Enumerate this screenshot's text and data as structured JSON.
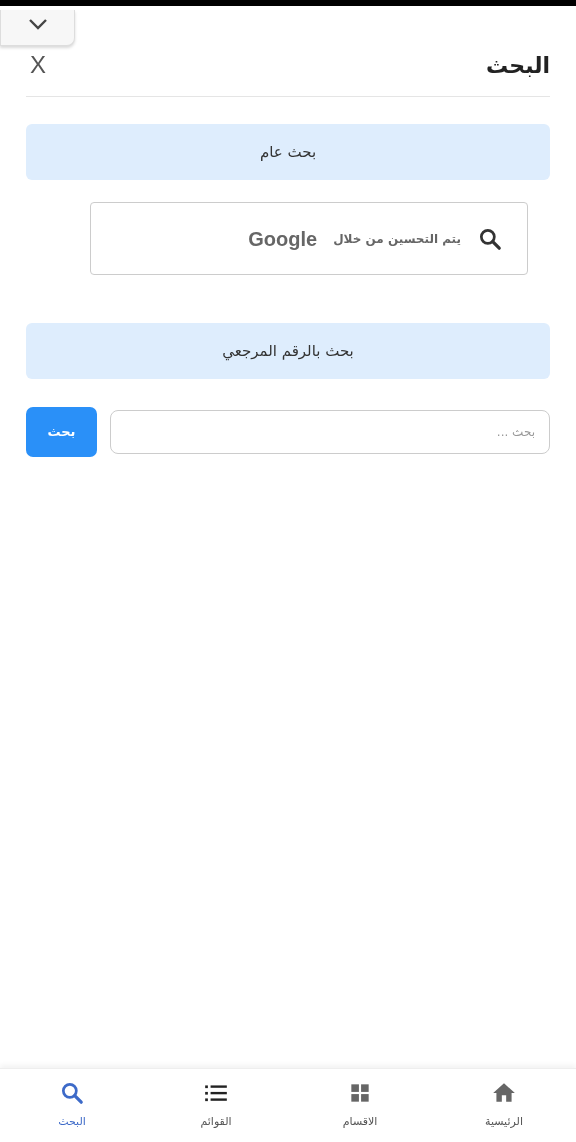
{
  "header": {
    "title": "البحث",
    "close": "X"
  },
  "sections": [
    {
      "kind": "google",
      "heading": "بحث عام",
      "powered_by": "يتم التحسين من خلال",
      "brand": "Google"
    },
    {
      "kind": "reference",
      "heading": "بحث بالرقم المرجعي",
      "placeholder": "بحث ...",
      "button": "بحث"
    }
  ],
  "bottom_nav": [
    {
      "kind": "home",
      "label": "الرئيسية",
      "selected": false
    },
    {
      "kind": "sections",
      "label": "الاقسام",
      "selected": false
    },
    {
      "kind": "lists",
      "label": "القوائم",
      "selected": false
    },
    {
      "kind": "search",
      "label": "البحث",
      "selected": true
    }
  ]
}
